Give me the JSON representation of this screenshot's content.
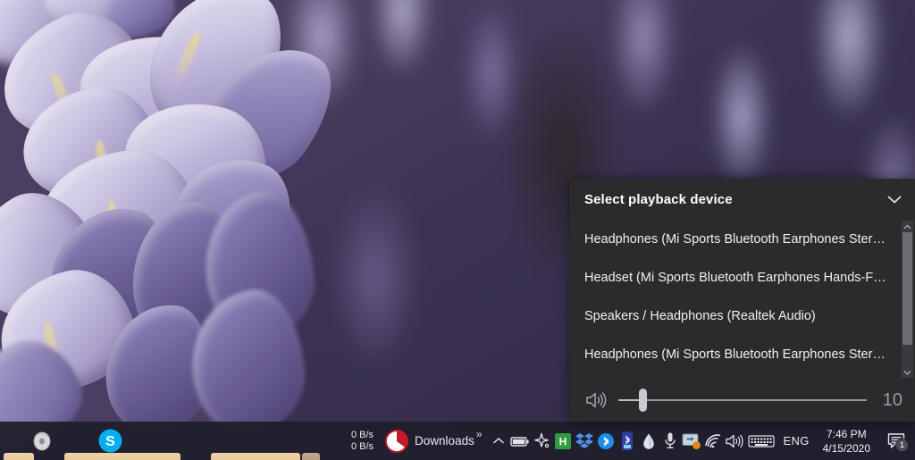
{
  "desktop": {
    "wallpaper_description": "Close-up photograph of purple wisteria flowers",
    "wallpaper_accent": "#8c7fb5"
  },
  "flyout": {
    "title": "Select playback device",
    "collapse_icon": "chevron-down-icon",
    "devices": [
      {
        "label": "Headphones (Mi Sports Bluetooth Earphones Stereo)",
        "selected": true
      },
      {
        "label": "Headset (Mi Sports Bluetooth Earphones Hands-Free...",
        "selected": false
      },
      {
        "label": "Speakers / Headphones (Realtek Audio)",
        "selected": false
      },
      {
        "label": "Headphones (Mi Sports Bluetooth Earphones Stereo)",
        "selected": false
      }
    ],
    "scrollbar": {
      "up_arrow": "chevron-up-icon",
      "down_arrow": "chevron-down-icon"
    },
    "volume": {
      "icon": "speaker-volume-icon",
      "value": "10",
      "percent": 10
    },
    "background_color": "#2b2b2e"
  },
  "taskbar": {
    "background_color": "#201e2a",
    "apps": [
      {
        "name": "disc-app-icon",
        "label": ""
      },
      {
        "name": "skype-icon",
        "label": ""
      }
    ],
    "net_speed": {
      "upload": "0 B/s",
      "download": "0 B/s"
    },
    "downloads": {
      "icon": "download-manager-icon",
      "label": "Downloads",
      "overflow_chevron": "»"
    },
    "tray_icons": [
      "show-hidden-icons-chevron",
      "battery-icon",
      "spark-icon",
      "h-app-icon",
      "dropbox-icon",
      "bluetooth-blue-icon",
      "bluetooth-battery-icon",
      "water-drop-icon",
      "microphone-icon",
      "display-switch-icon",
      "wifi-icon",
      "speaker-icon",
      "keyboard-icon"
    ],
    "language": "ENG",
    "clock": {
      "time": "7:46 PM",
      "date": "4/15/2020"
    },
    "notifications": {
      "icon": "action-center-icon",
      "badge": "1"
    }
  }
}
